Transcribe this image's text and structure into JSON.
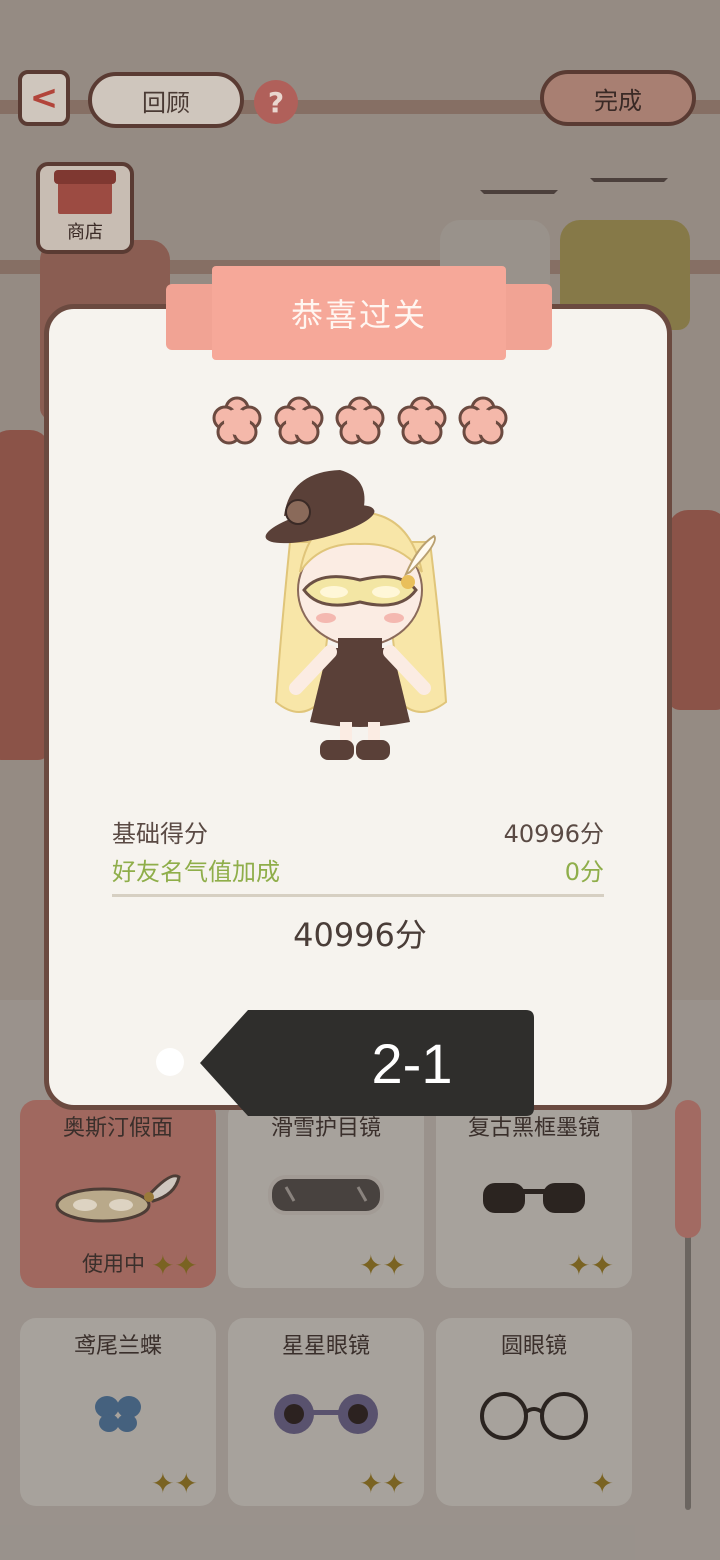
{
  "header": {
    "back_label": "<",
    "review_label": "回顾",
    "help_label": "?",
    "done_label": "完成",
    "shop_label": "商店"
  },
  "result": {
    "title": "恭喜过关",
    "stars": 5,
    "base_score_label": "基础得分",
    "base_score_value": "40996分",
    "bonus_label": "好友名气值加成",
    "bonus_value": "0分",
    "total": "40996分",
    "level": "2-1"
  },
  "items": [
    {
      "name": "奥斯汀假面",
      "status": "使用中",
      "icon": "masquerade-mask-icon"
    },
    {
      "name": "滑雪护目镜",
      "status": "",
      "icon": "ski-goggles-icon"
    },
    {
      "name": "复古黑框墨镜",
      "status": "",
      "icon": "retro-sunglasses-icon"
    },
    {
      "name": "鸢尾兰蝶",
      "status": "",
      "icon": "butterfly-icon"
    },
    {
      "name": "星星眼镜",
      "status": "",
      "icon": "flower-glasses-icon"
    },
    {
      "name": "圆眼镜",
      "status": "",
      "icon": "round-glasses-icon"
    }
  ],
  "colors": {
    "ribbon": "#f6a899",
    "modal_bg": "#f6f3ee",
    "border": "#6b4a40",
    "bonus_green": "#8fae4a",
    "star_pink": "#f4b8aa"
  }
}
